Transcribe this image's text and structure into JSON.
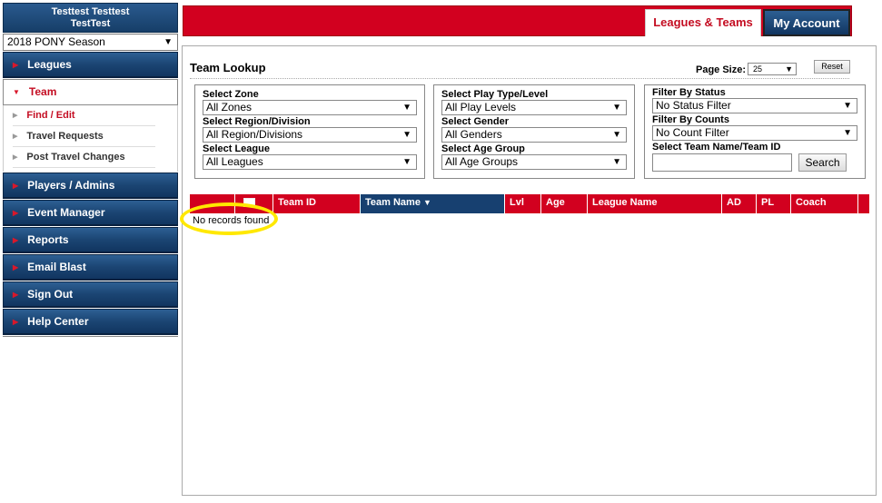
{
  "sidebar": {
    "user_line1": "Testtest Testtest",
    "user_line2": "TestTest",
    "season": "2018 PONY Season",
    "nav": {
      "leagues": "Leagues",
      "team": "Team",
      "players_admins": "Players / Admins",
      "event_manager": "Event Manager",
      "reports": "Reports",
      "email_blast": "Email Blast",
      "sign_out": "Sign Out",
      "help_center": "Help Center"
    },
    "team_sub": {
      "find_edit": "Find / Edit",
      "travel_requests": "Travel Requests",
      "post_travel_changes": "Post Travel Changes"
    }
  },
  "topbar": {
    "tab_leagues": "Leagues & Teams",
    "tab_account": "My Account"
  },
  "main": {
    "title": "Team Lookup",
    "page_size_label": "Page Size:",
    "page_size": "25",
    "reset": "Reset",
    "filters": {
      "zone_label": "Select Zone",
      "zone": "All Zones",
      "region_label": "Select Region/Division",
      "region": "All Region/Divisions",
      "league_label": "Select League",
      "league": "All Leagues",
      "play_type_label": "Select Play Type/Level",
      "play_type": "All Play Levels",
      "gender_label": "Select Gender",
      "gender": "All Genders",
      "age_group_label": "Select Age Group",
      "age_group": "All Age Groups",
      "status_label": "Filter By Status",
      "status": "No Status Filter",
      "counts_label": "Filter By Counts",
      "counts": "No Count Filter",
      "team_name_label": "Select Team Name/Team ID",
      "search_button": "Search"
    },
    "table": {
      "columns": [
        "Team ID",
        "Team Name",
        "Lvl",
        "Age",
        "League Name",
        "AD",
        "PL",
        "Coach"
      ],
      "empty_message": "No records found"
    }
  },
  "colors": {
    "accent_red": "#d2001f",
    "nav_blue": "#1b4573",
    "highlight": "#ffe800"
  }
}
